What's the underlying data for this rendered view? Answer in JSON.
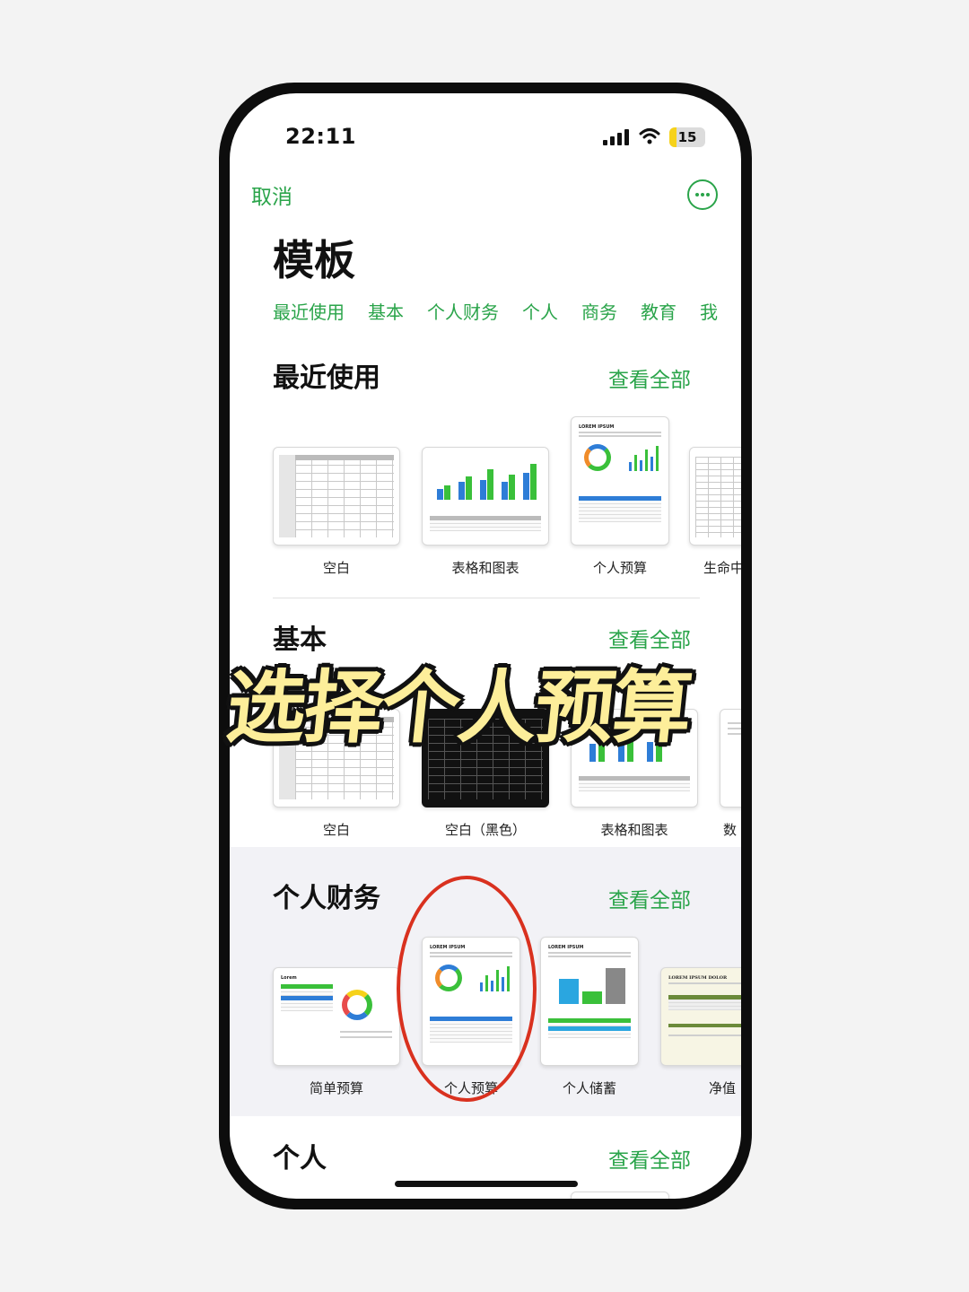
{
  "status": {
    "time": "22:11",
    "battery": "15"
  },
  "nav": {
    "cancel": "取消",
    "more_icon": "ellipsis-circle-icon"
  },
  "page_title": "模板",
  "tabs": [
    "最近使用",
    "基本",
    "个人财务",
    "个人",
    "商务",
    "教育",
    "我"
  ],
  "sections": {
    "recent": {
      "title": "最近使用",
      "see_all": "查看全部",
      "items": [
        "空白",
        "表格和图表",
        "个人预算",
        "生命中"
      ]
    },
    "basic": {
      "title": "基本",
      "see_all": "查看全部",
      "items": [
        "空白",
        "空白（黑色）",
        "表格和图表",
        "数"
      ]
    },
    "finance": {
      "title": "个人财务",
      "see_all": "查看全部",
      "items": [
        "简单预算",
        "个人预算",
        "个人储蓄",
        "净值"
      ]
    },
    "personal": {
      "title": "个人",
      "see_all": "查看全部"
    }
  },
  "thumb_text": {
    "lorem_ipsum": "LOREM IPSUM",
    "lorem": "Lorem",
    "lorem_ipsum_dolor": "LOREM IPSUM DOLOR"
  },
  "overlay_caption": "选择个人预算",
  "colors": {
    "accent": "#2aa44a",
    "highlight_ring": "#d9311f",
    "caption_fill": "#fdee9a"
  }
}
